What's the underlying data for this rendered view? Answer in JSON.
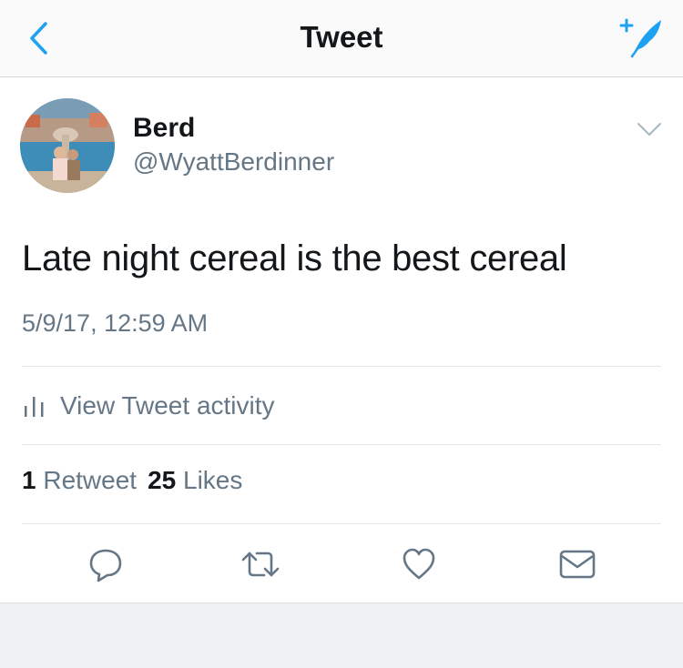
{
  "nav": {
    "title": "Tweet",
    "back_icon": "chevron-left-icon",
    "compose_icon": "compose-tweet-icon"
  },
  "tweet": {
    "author_name": "Berd",
    "author_handle": "@WyattBerdinner",
    "text": "Late night cereal is the best cereal",
    "timestamp": "5/9/17, 12:59 AM"
  },
  "activity": {
    "label": "View Tweet activity",
    "icon": "bar-chart-icon"
  },
  "stats": {
    "retweets_count": "1",
    "retweets_label": "Retweet",
    "likes_count": "25",
    "likes_label": "Likes"
  },
  "actions": [
    "reply-icon",
    "retweet-icon",
    "like-icon",
    "direct-message-icon"
  ],
  "colors": {
    "accent": "#1da1f2",
    "text": "#14171a",
    "secondary": "#657786",
    "divider": "#e1e8ed"
  }
}
